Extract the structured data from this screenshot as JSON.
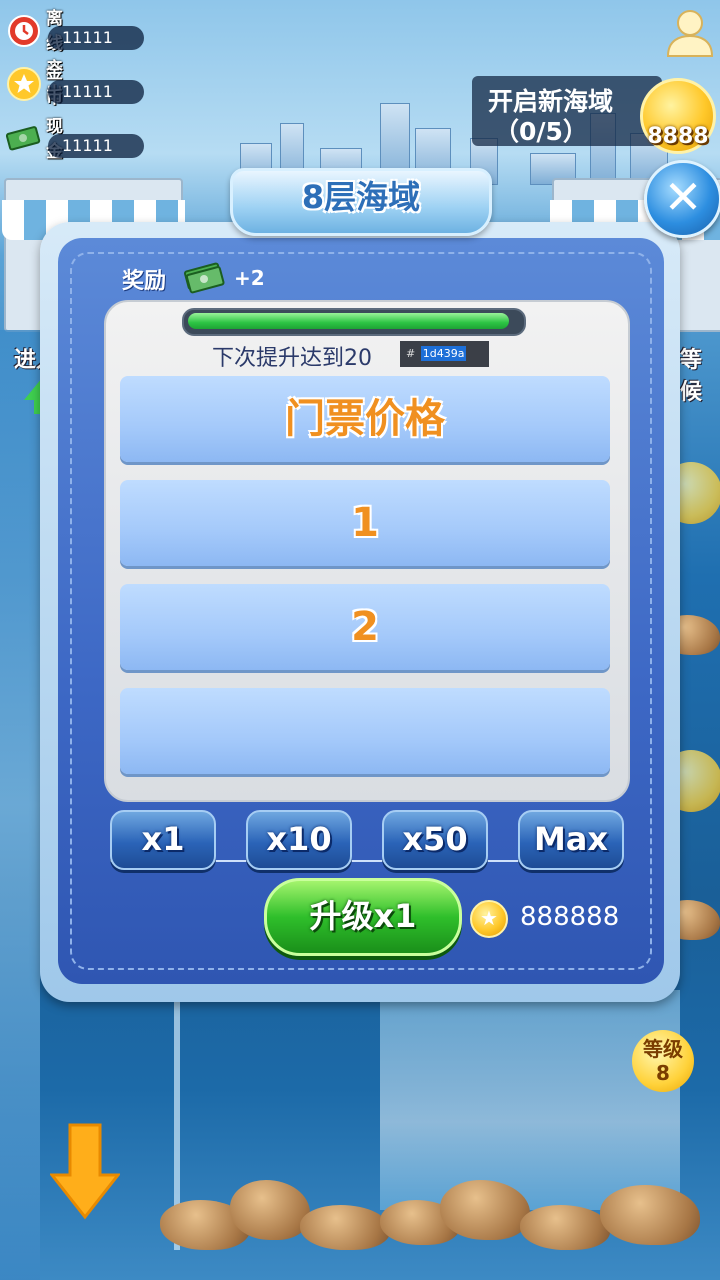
{
  "hud": {
    "offline_label": "离线产出",
    "offline_value": "11111",
    "gold_label": "金币",
    "gold_value": "11111",
    "cash_label": "现金",
    "cash_value": "11111"
  },
  "new_sea": {
    "title": "开启新海域",
    "progress": "（0/5）",
    "cost": "8888"
  },
  "side": {
    "enter_label": "进入",
    "wait_label": "等候",
    "level_label": "等级",
    "level_value": "8"
  },
  "panel": {
    "title": "8层海域",
    "reward_label": "奖励",
    "reward_value": "+2",
    "progress_fraction": 0.98,
    "next_text": "下次提升达到20",
    "hex_prefix": "#",
    "hex_value": "1d439a",
    "rows": [
      "门票价格",
      "1",
      "2",
      ""
    ],
    "multipliers": [
      "x1",
      "x10",
      "x50",
      "Max"
    ],
    "upgrade_label": "升级x1",
    "cost": "888888"
  },
  "colors": {
    "panel_blue": "#3d68c5",
    "row_text": "#f09020",
    "upgrade_green": "#2fbf2b"
  }
}
